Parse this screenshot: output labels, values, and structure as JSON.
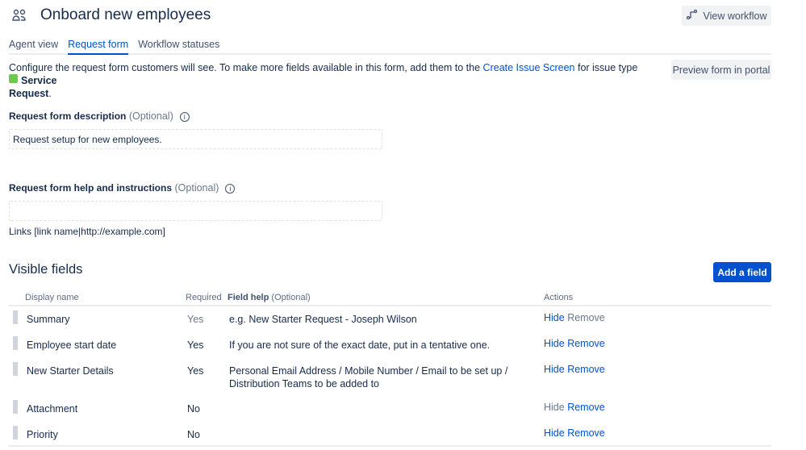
{
  "header": {
    "title": "Onboard new employees",
    "view_workflow": "View workflow"
  },
  "tabs": [
    {
      "label": "Agent view"
    },
    {
      "label": "Request form"
    },
    {
      "label": "Workflow statuses"
    }
  ],
  "intro": {
    "text_before": "Configure the request form customers will see. To make more fields available in this form, add them to the ",
    "link": "Create Issue Screen",
    "text_mid": " for issue type ",
    "issue_type_line1": "Service",
    "issue_type_line2": "Request",
    "period": ".",
    "preview_button": "Preview form in portal"
  },
  "description": {
    "label": "Request form description",
    "optional": "(Optional)",
    "value": "Request setup for new employees."
  },
  "help": {
    "label": "Request form help and instructions",
    "optional": "(Optional)",
    "value": "",
    "hint": "Links [link name|http://example.com]"
  },
  "visible_fields": {
    "title": "Visible fields",
    "add_button": "Add a field",
    "columns": {
      "name": "Display name",
      "required": "Required",
      "help": "Field help",
      "help_optional": "(Optional)",
      "actions": "Actions"
    },
    "rows": [
      {
        "name": "Summary",
        "required": "Yes",
        "help1": "e.g. New Starter Request - Joseph Wilson",
        "help2": "",
        "hide": "Hide",
        "remove": "Remove",
        "hide_enabled": true,
        "remove_enabled": false
      },
      {
        "name": "Employee start date",
        "required": "Yes",
        "help1": "If you are not sure of the exact date, put in a tentative one.",
        "help2": "",
        "hide": "Hide",
        "remove": "Remove",
        "hide_enabled": true,
        "remove_enabled": true
      },
      {
        "name": "New Starter Details",
        "required": "Yes",
        "help1": "Personal Email Address / Mobile Number / Email to be set up /",
        "help2": "Distribution Teams to be added to",
        "hide": "Hide",
        "remove": "Remove",
        "hide_enabled": true,
        "remove_enabled": true
      },
      {
        "name": "Attachment",
        "required": "No",
        "help1": "",
        "help2": "",
        "hide": "Hide",
        "remove": "Remove",
        "hide_enabled": false,
        "remove_enabled": true
      },
      {
        "name": "Priority",
        "required": "No",
        "help1": "",
        "help2": "",
        "hide": "Hide",
        "remove": "Remove",
        "hide_enabled": true,
        "remove_enabled": true
      }
    ]
  },
  "colors": {
    "accent": "#0052cc",
    "issue_type": "#6bc950"
  }
}
